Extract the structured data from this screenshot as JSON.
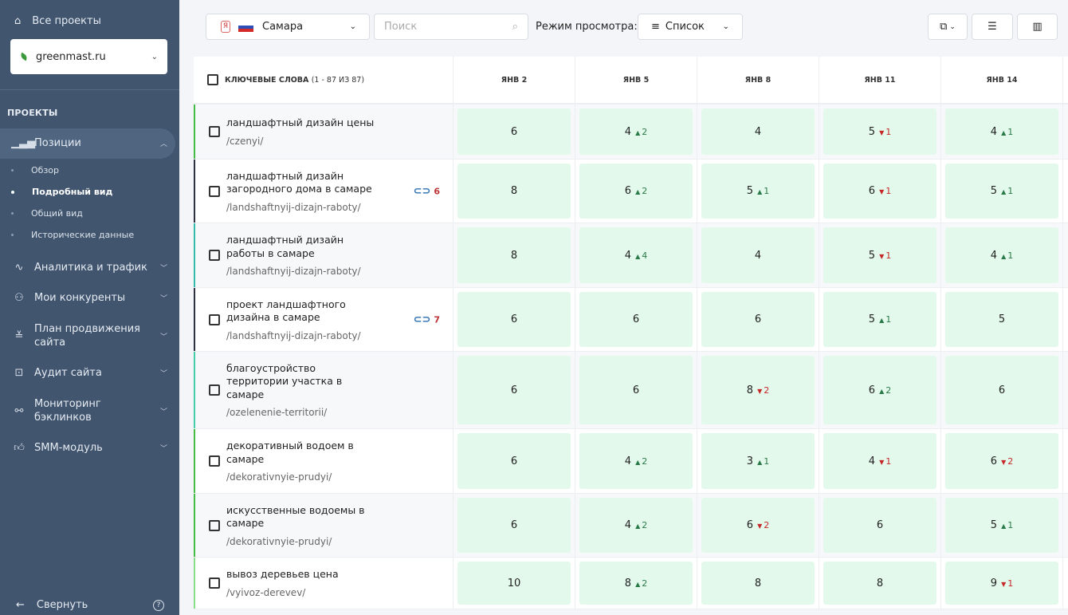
{
  "sidebar": {
    "all_projects": "Все проекты",
    "project": "greenmast.ru",
    "section": "ПРОЕКТЫ",
    "positions": "Позиции",
    "sub": [
      "Обзор",
      "Подробный вид",
      "Общий вид",
      "Исторические данные"
    ],
    "items": [
      {
        "label": "Аналитика и трафик",
        "icon": "activity-icon"
      },
      {
        "label": "Мои конкуренты",
        "icon": "users-icon"
      },
      {
        "label": "План продвижения сайта",
        "icon": "checklist-icon"
      },
      {
        "label": "Аудит сайта",
        "icon": "audit-icon"
      },
      {
        "label": "Мониторинг бэклинков",
        "icon": "link-icon"
      },
      {
        "label": "SMM-модуль",
        "icon": "thumbs-up-icon"
      }
    ],
    "collapse": "Свернуть"
  },
  "toolbar": {
    "region": "Самара",
    "search_placeholder": "Поиск",
    "view_label": "Режим просмотра:",
    "view_value": "Список"
  },
  "table": {
    "keyword_header": "КЛЮЧЕВЫЕ СЛОВА",
    "keyword_count": "(1 - 87 ИЗ 87)",
    "dates": [
      "ЯНВ 2",
      "ЯНВ 5",
      "ЯНВ 8",
      "ЯНВ 11",
      "ЯНВ 14"
    ],
    "rows": [
      {
        "keyword": "ландшафтный дизайн цены",
        "url": "/czenyi/",
        "bar": "#44bb44",
        "cells": [
          [
            "6"
          ],
          [
            "4",
            "up",
            "2"
          ],
          [
            "4"
          ],
          [
            "5",
            "dn",
            "1"
          ],
          [
            "4",
            "up",
            "1"
          ]
        ]
      },
      {
        "keyword": "ландшафтный дизайн загородного дома в самаре",
        "url": "/landshaftnyij-dizajn-raboty/",
        "bar": "#2d3142",
        "links": "6",
        "cells": [
          [
            "8"
          ],
          [
            "6",
            "up",
            "2"
          ],
          [
            "5",
            "up",
            "1"
          ],
          [
            "6",
            "dn",
            "1"
          ],
          [
            "5",
            "up",
            "1"
          ]
        ]
      },
      {
        "keyword": "ландшафтный дизайн работы в самаре",
        "url": "/landshaftnyij-dizajn-raboty/",
        "bar": "#33bbaa",
        "cells": [
          [
            "8"
          ],
          [
            "4",
            "up",
            "4"
          ],
          [
            "4"
          ],
          [
            "5",
            "dn",
            "1"
          ],
          [
            "4",
            "up",
            "1"
          ]
        ]
      },
      {
        "keyword": "проект ландшафтного дизайна в самаре",
        "url": "/landshaftnyij-dizajn-raboty/",
        "bar": "#2d3142",
        "links": "7",
        "cells": [
          [
            "6"
          ],
          [
            "6"
          ],
          [
            "6"
          ],
          [
            "5",
            "up",
            "1"
          ],
          [
            "5"
          ]
        ]
      },
      {
        "keyword": "благоустройство территории участка в самаре",
        "url": "/ozelenenie-territorii/",
        "bar": "#44ccaa",
        "cells": [
          [
            "6"
          ],
          [
            "6"
          ],
          [
            "8",
            "dn",
            "2"
          ],
          [
            "6",
            "up",
            "2"
          ],
          [
            "6"
          ]
        ]
      },
      {
        "keyword": "декоративный водоем в самаре",
        "url": "/dekorativnyie-prudyi/",
        "bar": "#44bb44",
        "cells": [
          [
            "6"
          ],
          [
            "4",
            "up",
            "2"
          ],
          [
            "3",
            "up",
            "1"
          ],
          [
            "4",
            "dn",
            "1"
          ],
          [
            "6",
            "dn",
            "2"
          ]
        ]
      },
      {
        "keyword": "искусственные водоемы в самаре",
        "url": "/dekorativnyie-prudyi/",
        "bar": "#44bb44",
        "cells": [
          [
            "6"
          ],
          [
            "4",
            "up",
            "2"
          ],
          [
            "6",
            "dn",
            "2"
          ],
          [
            "6"
          ],
          [
            "5",
            "up",
            "1"
          ]
        ]
      },
      {
        "keyword": "вывоз деревьев цена",
        "url": "/vyivoz-derevev/",
        "bar": "#88dd88",
        "cells": [
          [
            "10"
          ],
          [
            "8",
            "up",
            "2"
          ],
          [
            "8"
          ],
          [
            "8"
          ],
          [
            "9",
            "dn",
            "1"
          ]
        ]
      }
    ]
  }
}
